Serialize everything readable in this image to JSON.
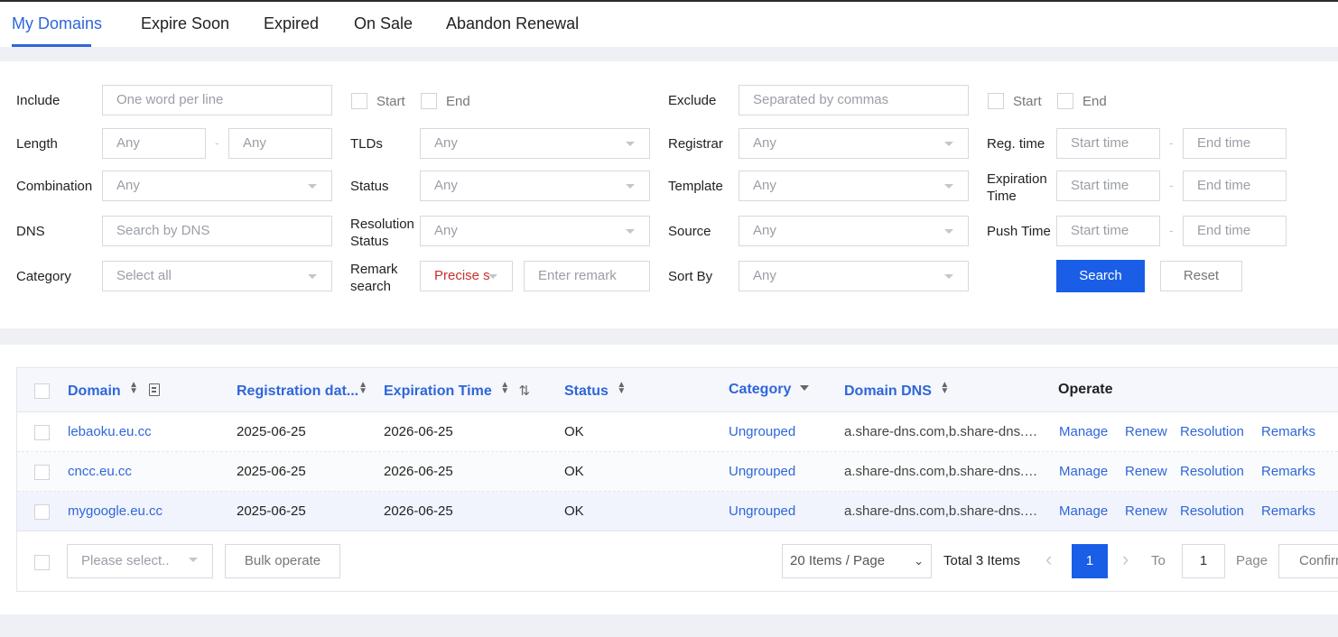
{
  "tabs": [
    {
      "label": "My Domains"
    },
    {
      "label": "Expire Soon"
    },
    {
      "label": "Expired"
    },
    {
      "label": "On Sale"
    },
    {
      "label": "Abandon Renewal"
    }
  ],
  "filters": {
    "include": {
      "label": "Include",
      "placeholder": "One word per line"
    },
    "start": "Start",
    "end": "End",
    "exclude": {
      "label": "Exclude",
      "placeholder": "Separated by commas"
    },
    "length": {
      "label": "Length",
      "min": "Any",
      "max": "Any"
    },
    "tlds": {
      "label": "TLDs",
      "value": "Any"
    },
    "registrar": {
      "label": "Registrar",
      "value": "Any"
    },
    "reg_time": {
      "label": "Reg. time",
      "start": "Start time",
      "end": "End time"
    },
    "combination": {
      "label": "Combination",
      "value": "Any"
    },
    "status": {
      "label": "Status",
      "value": "Any"
    },
    "template": {
      "label": "Template",
      "value": "Any"
    },
    "expiration_time": {
      "label_1": "Expiration",
      "label_2": "Time",
      "start": "Start time",
      "end": "End time"
    },
    "dns": {
      "label": "DNS",
      "placeholder": "Search by DNS"
    },
    "resolution_status": {
      "label_1": "Resolution",
      "label_2": "Status",
      "value": "Any"
    },
    "source": {
      "label": "Source",
      "value": "Any"
    },
    "push_time": {
      "label": "Push Time",
      "start": "Start time",
      "end": "End time"
    },
    "category": {
      "label": "Category",
      "value": "Select all"
    },
    "remark_search": {
      "label_1": "Remark",
      "label_2": "search",
      "mode": "Precise s",
      "placeholder": "Enter remark"
    },
    "sort_by": {
      "label": "Sort By",
      "value": "Any"
    },
    "search_label": "Search",
    "reset_label": "Reset",
    "dash": "-"
  },
  "table": {
    "columns": {
      "domain": "Domain",
      "registration": "Registration dat...",
      "expiration": "Expiration Time",
      "status": "Status",
      "category": "Category",
      "dns": "Domain DNS",
      "operate": "Operate"
    },
    "rows": [
      {
        "domain": "lebaoku.eu.cc",
        "registration": "2025-06-25",
        "expiration": "2026-06-25",
        "status": "OK",
        "category": "Ungrouped",
        "dns": "a.share-dns.com,b.share-dns.net"
      },
      {
        "domain": "cncc.eu.cc",
        "registration": "2025-06-25",
        "expiration": "2026-06-25",
        "status": "OK",
        "category": "Ungrouped",
        "dns": "a.share-dns.com,b.share-dns.net"
      },
      {
        "domain": "mygoogle.eu.cc",
        "registration": "2025-06-25",
        "expiration": "2026-06-25",
        "status": "OK",
        "category": "Ungrouped",
        "dns": "a.share-dns.com,b.share-dns.net"
      }
    ],
    "operations": [
      "Manage",
      "Renew",
      "Resolution",
      "Remarks"
    ]
  },
  "footer": {
    "bulk_select_placeholder": "Please select..",
    "bulk_operate_label": "Bulk operate",
    "page_size": "20 Items / Page",
    "total": "Total 3 Items",
    "current_page": "1",
    "to_label": "To",
    "goto_value": "1",
    "page_label": "Page",
    "confirm_label": "Confirm"
  },
  "colors": {
    "accent": "#2f66d9",
    "primary_button": "#1a5ee8"
  }
}
